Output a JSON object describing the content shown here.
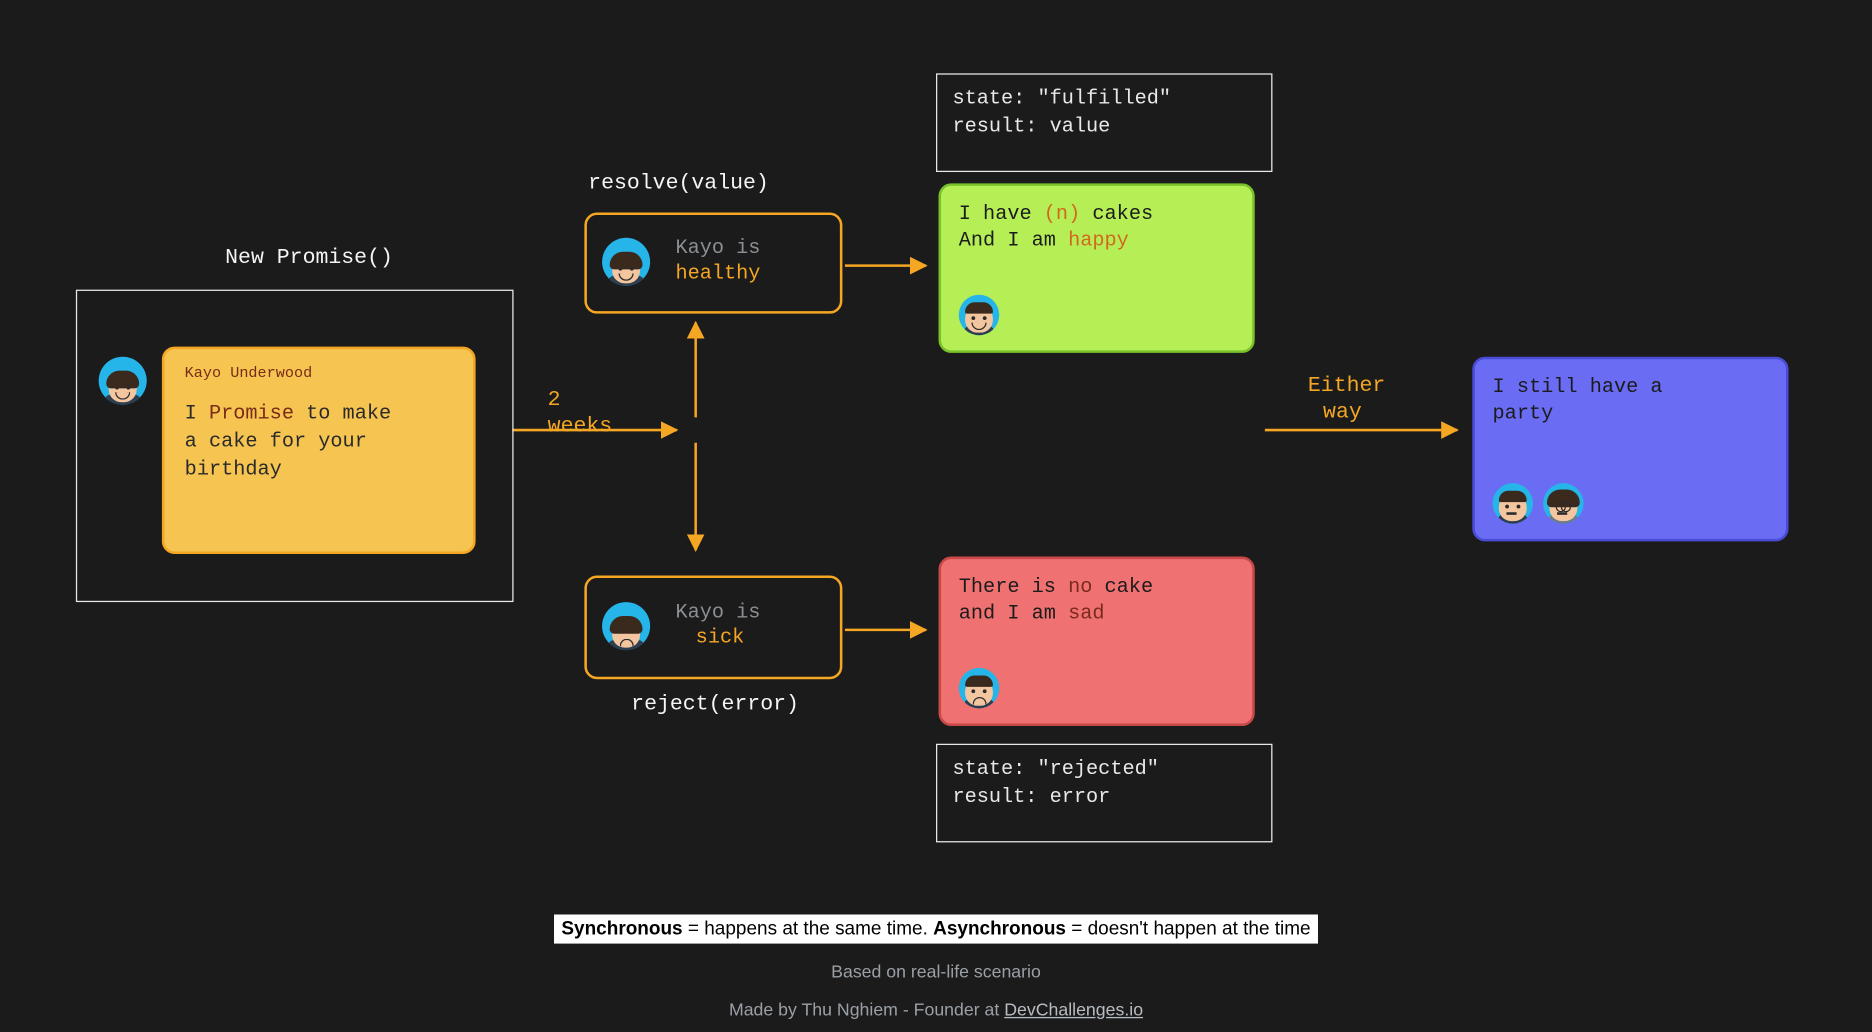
{
  "labels": {
    "newPromise": "New Promise()",
    "resolve": "resolve(value)",
    "reject": "reject(error)",
    "twoWeeks1": "2",
    "twoWeeks2": "weeks",
    "either1": "Either",
    "either2": "way"
  },
  "promiseCard": {
    "author": "Kayo Underwood",
    "t1": "I ",
    "hl": "Promise",
    "t2": " to make",
    "line2": "a cake for your",
    "line3": "birthday"
  },
  "healthy": {
    "pre": "Kayo is",
    "word": "healthy"
  },
  "sick": {
    "pre": "Kayo is",
    "word": "sick"
  },
  "fulfilledState": {
    "line1": "state: \"fulfilled\"",
    "line2": "result: value"
  },
  "rejectedState": {
    "line1": "state: \"rejected\"",
    "line2": "result: error"
  },
  "greenNote": {
    "l1a": "I have ",
    "l1hl": "(n)",
    "l1b": " cakes",
    "l2a": "And I am ",
    "l2hl": "happy"
  },
  "redNote": {
    "l1a": "There is ",
    "l1hl": "no",
    "l1b": " cake",
    "l2a": "and I am ",
    "l2hl": "sad"
  },
  "blueNote": {
    "l1": "I still have a",
    "l2": "party"
  },
  "footer": {
    "sync_b": "Synchronous",
    "sync_t": " = happens at the same time. ",
    "async_b": "Asynchronous",
    "async_t": " = doesn't happen at the time",
    "based": "Based on real-life scenario",
    "made_pre": "Made by Thu Nghiem - Founder at ",
    "made_link": "DevChallenges.io"
  }
}
